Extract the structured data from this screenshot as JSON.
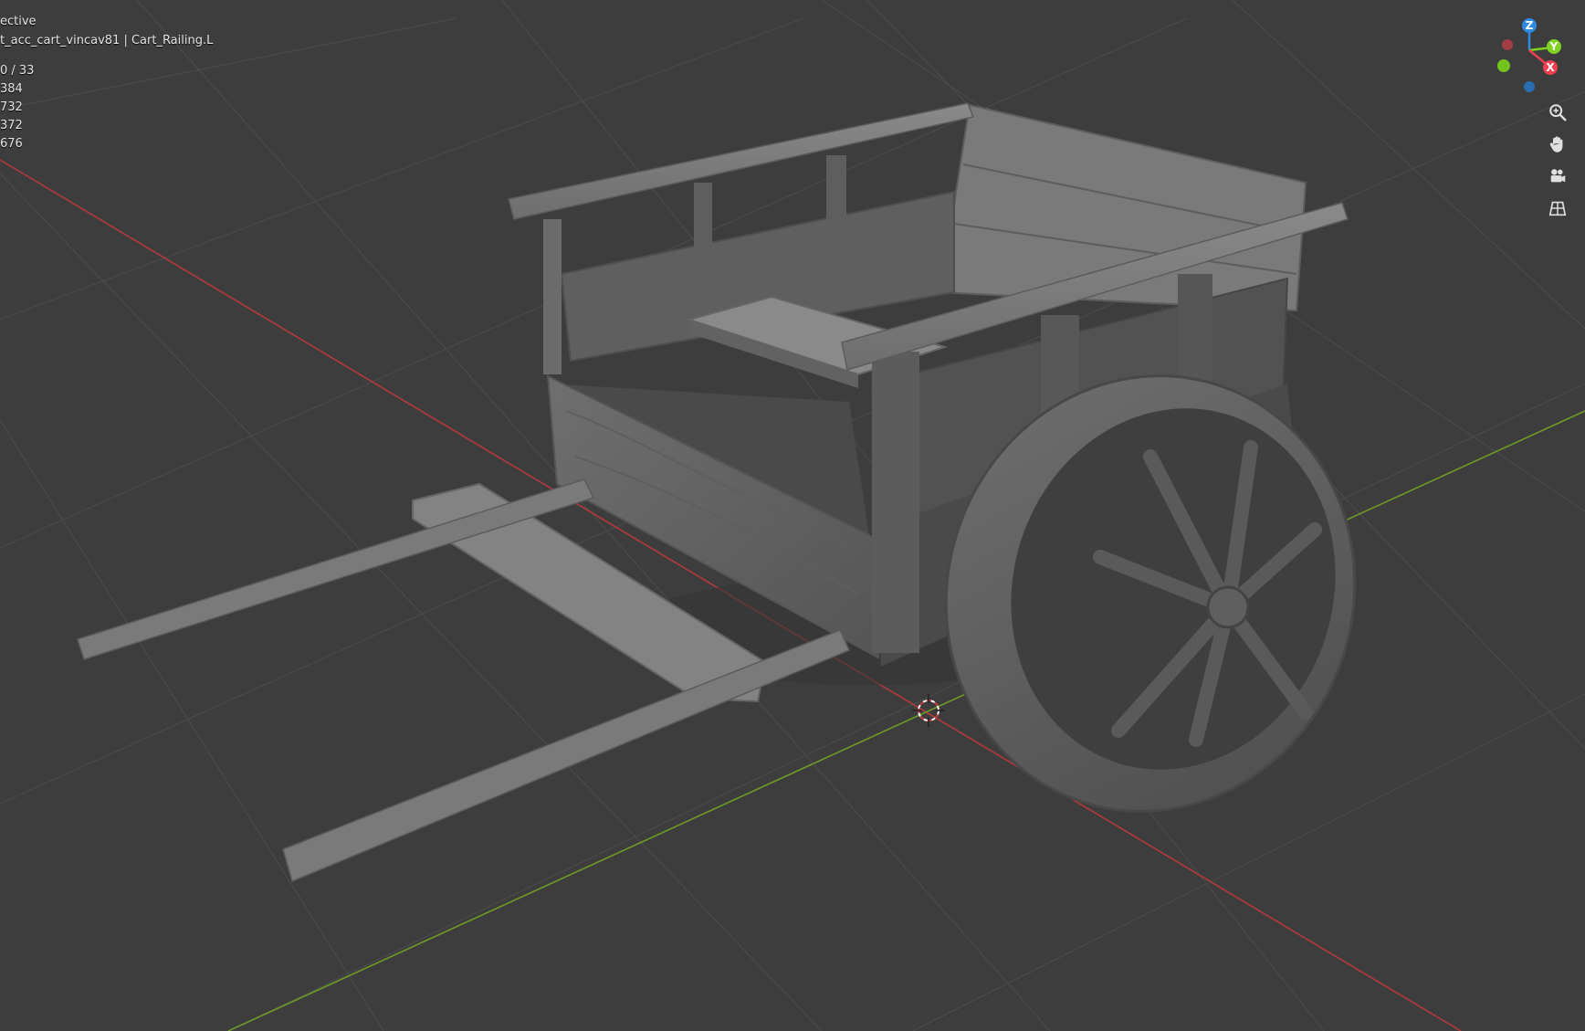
{
  "overlay": {
    "view_mode": "ective",
    "object_path": "t_acc_cart_vincav81 | Cart_Railing.L",
    "stats": [
      "0 / 33",
      "384",
      "732",
      "372",
      "676"
    ]
  },
  "gizmo": {
    "axis_z": "Z",
    "axis_y": "Y",
    "axis_x": "X",
    "color_x": "#f0414f",
    "color_y": "#7ed320",
    "color_z": "#2e8be0"
  },
  "nav_icons": [
    "zoom-icon",
    "pan-hand-icon",
    "camera-icon",
    "ortho-grid-icon"
  ],
  "colors": {
    "background": "#3d3d3d",
    "grid": "#4a4a4a",
    "x_axis_line": "#b33a3a",
    "y_axis_line": "#6e9a28",
    "mesh": "#767676"
  }
}
